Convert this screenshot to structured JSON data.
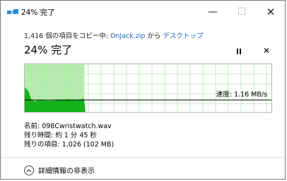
{
  "window": {
    "title": "24% 完了",
    "minimize_symbol": "—",
    "maximize_symbol": "☐",
    "close_symbol": "✕"
  },
  "copy_status": {
    "prefix": "1,416 個の項目をコピー中: ",
    "source": "OnJack.zip",
    "middle": " から ",
    "destination": "デスクトップ"
  },
  "progress": {
    "heading": "24% 完了",
    "percent": 24,
    "speed_label": "速度: 1.16 MB/s"
  },
  "controls": {
    "pause_icon": "pause-icon",
    "cancel_symbol": "✕"
  },
  "details": {
    "name": "名前: 098Cwristwatch.wav",
    "time_remaining": "残り時間: 約 1 分 45 秒",
    "items_remaining": "残りの項目: 1,026 (102 MB)"
  },
  "toggle": {
    "label": "詳細情報の非表示",
    "icon": "chevron-up-icon"
  },
  "colors": {
    "progress_fill": "#b2ecaa",
    "speed_area": "#13b31b",
    "link": "#1a64b8",
    "grid": "#c8e8c4"
  }
}
